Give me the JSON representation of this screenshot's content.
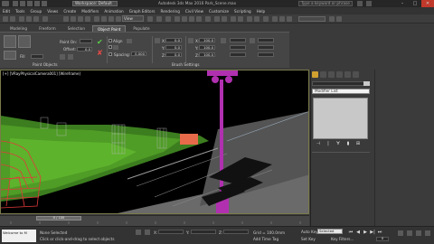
{
  "titlebar": {
    "workspace": "Workspace: Default",
    "title": "Autodesk 3ds Max 2016   Park_Scene.max",
    "search_placeholder": "Type a keyword or phrase",
    "minimize": "–",
    "maximize": "□",
    "close": "✕"
  },
  "menubar": {
    "items": [
      "Edit",
      "Tools",
      "Group",
      "Views",
      "Create",
      "Modifiers",
      "Animation",
      "Graph Editors",
      "Rendering",
      "Civil View",
      "Customize",
      "Scripting",
      "Help"
    ]
  },
  "toolbar": {
    "view_select": "View"
  },
  "ribbon": {
    "tabs": [
      "Modeling",
      "Freeform",
      "Selection",
      "Object Paint",
      "Populate"
    ],
    "active_tab": "Object Paint",
    "paint_on": "Paint On:",
    "offset_label": "Offset:",
    "offset_value": "0.0",
    "fill_label": "Fill",
    "align_label": "Align",
    "spacing_label": "Spacing:",
    "spacing_value": "0.000",
    "scale_value": "100.0",
    "paint_objects": "Paint Objects",
    "brush_settings": "Brush Settings",
    "check_icon": "✔",
    "x_icon": "✘",
    "x_label": "X:",
    "y_label": "Y:",
    "z_label": "Z:",
    "rot_x": "0.0",
    "rot_y": "0.0",
    "rot_z": "0.0",
    "scale_x": "100.0",
    "scale_y": "100.0",
    "scale_z": "100.0"
  },
  "viewport": {
    "label": "[+] [VRayPhysicalCamera001] [Wireframe]"
  },
  "command_panel": {
    "modifier_list": "Modifier List",
    "stack_buttons": [
      "⊣",
      "|",
      "∀",
      "▮",
      "⊞"
    ]
  },
  "timeline": {
    "slider": "0 / 100",
    "ticks": [
      "0",
      "10",
      "20",
      "30",
      "40",
      "50",
      "60",
      "70",
      "80",
      "90",
      "100"
    ]
  },
  "statusbar": {
    "maxscript": "Welcome to M",
    "status": "None Selected",
    "prompt": "Click or click-and-drag to select objects",
    "x_label": "X:",
    "y_label": "Y:",
    "z_label": "Z:",
    "grid": "Grid = 100.0mm",
    "add_time_tag": "Add Time Tag",
    "auto_key": "Auto Key",
    "auto_key_value": "Selected",
    "set_key": "Set Key",
    "key_filters": "Key Filters...",
    "frame": "0",
    "playback": [
      "⏮",
      "◀",
      "▶",
      "▶|",
      "⏭"
    ]
  }
}
